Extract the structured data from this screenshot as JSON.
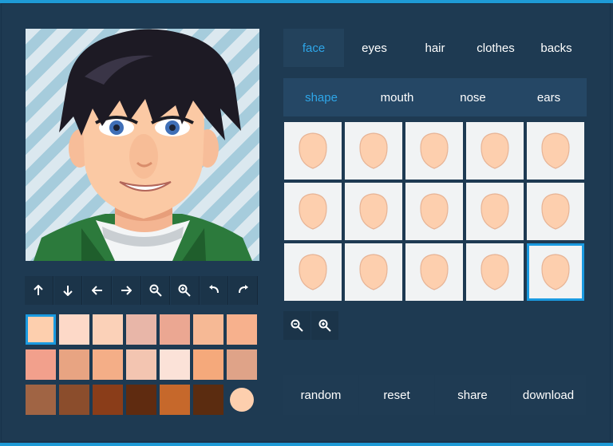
{
  "colors": {
    "background": "#1e3a52",
    "accent": "#1e9ad6",
    "active_text": "#2ea6e8",
    "face_skin": "#fdcfae"
  },
  "tabs": [
    {
      "label": "face",
      "active": true
    },
    {
      "label": "eyes",
      "active": false
    },
    {
      "label": "hair",
      "active": false
    },
    {
      "label": "clothes",
      "active": false
    },
    {
      "label": "backs",
      "active": false
    }
  ],
  "subtabs": [
    {
      "label": "shape",
      "active": true
    },
    {
      "label": "mouth",
      "active": false
    },
    {
      "label": "nose",
      "active": false
    },
    {
      "label": "ears",
      "active": false
    }
  ],
  "controls": [
    {
      "icon": "arrow-up-icon"
    },
    {
      "icon": "arrow-down-icon"
    },
    {
      "icon": "arrow-left-icon"
    },
    {
      "icon": "arrow-right-icon"
    },
    {
      "icon": "zoom-out-icon"
    },
    {
      "icon": "zoom-in-icon"
    },
    {
      "icon": "undo-icon"
    },
    {
      "icon": "redo-icon"
    }
  ],
  "skin_palette": [
    "#fdcfae",
    "#fdd9c8",
    "#fbd1b8",
    "#e8b6a8",
    "#eba792",
    "#f6b995",
    "#f7b18d",
    "#f2a08c",
    "#e8a482",
    "#f4ae87",
    "#f3c5b1",
    "#fbe2d8",
    "#f5a97b",
    "#dfa388",
    "#a06444",
    "#8b4d2c",
    "#8a3d19",
    "#5f2b10",
    "#c6682b",
    "#5b2c10",
    "#fdcfae"
  ],
  "selected_skin_index": 0,
  "face_shapes_count": 15,
  "selected_shape_index": 14,
  "zoom_buttons": [
    {
      "icon": "zoom-out-icon"
    },
    {
      "icon": "zoom-in-icon"
    }
  ],
  "actions": [
    {
      "label": "random"
    },
    {
      "label": "reset"
    },
    {
      "label": "share"
    },
    {
      "label": "download"
    }
  ]
}
